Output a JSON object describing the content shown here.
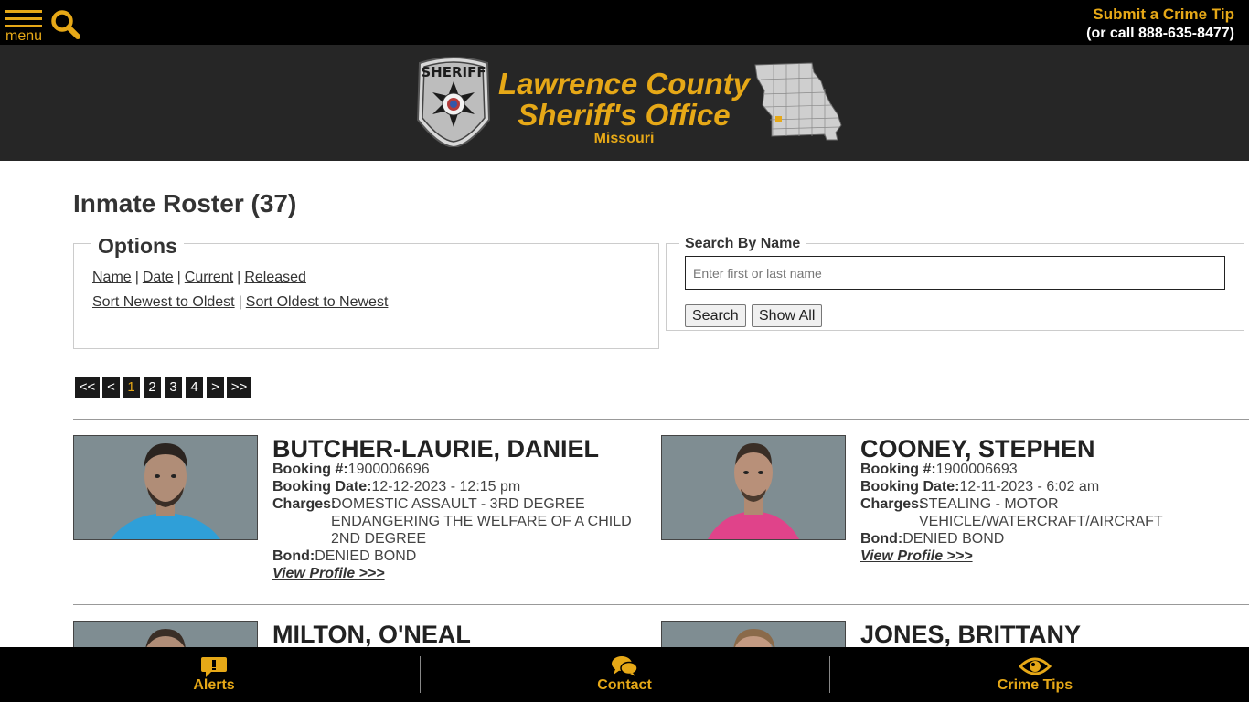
{
  "header": {
    "menu_label": "menu",
    "tip_title": "Submit a Crime Tip",
    "tip_phone": "(or call 888-635-8477)"
  },
  "brand": {
    "line1": "Lawrence County",
    "line2": "Sheriff's Office",
    "state": "Missouri",
    "badge_text": "SHERIFF"
  },
  "page": {
    "title": "Inmate Roster (37)"
  },
  "options": {
    "legend": "Options",
    "sort_by": [
      "Name",
      "Date",
      "Current",
      "Released"
    ],
    "sort_order": [
      "Sort Newest to Oldest",
      "Sort Oldest to Newest"
    ],
    "separator": "|"
  },
  "search": {
    "legend": "Search By Name",
    "placeholder": "Enter first or last name",
    "search_button": "Search",
    "show_all_button": "Show All"
  },
  "pagination": {
    "first": "<<",
    "prev": "<",
    "pages": [
      "1",
      "2",
      "3",
      "4"
    ],
    "current": "1",
    "next": ">",
    "last": ">>"
  },
  "labels": {
    "booking_no": "Booking #:",
    "booking_date": "Booking Date:",
    "charges": "Charges:",
    "bond": "Bond:",
    "view_profile": "View Profile >>>"
  },
  "inmates": [
    {
      "name": "BUTCHER-LAURIE, DANIEL",
      "booking_no": "1900006696",
      "booking_date": "12-12-2023 - 12:15 pm",
      "charges": [
        "DOMESTIC ASSAULT - 3RD DEGREE",
        "ENDANGERING THE WELFARE OF A CHILD 2ND DEGREE"
      ],
      "bond": "DENIED BOND",
      "shirt_color": "#2f9fd8"
    },
    {
      "name": "COONEY, STEPHEN",
      "booking_no": "1900006693",
      "booking_date": "12-11-2023 - 6:02 am",
      "charges": [
        "STEALING - MOTOR VEHICLE/WATERCRAFT/AIRCRAFT"
      ],
      "bond": "DENIED BOND",
      "shirt_color": "#e0438a"
    },
    {
      "name": "MILTON, O'NEAL"
    },
    {
      "name": "JONES, BRITTANY"
    }
  ],
  "footer": {
    "items": [
      {
        "label": "Alerts",
        "icon": "alert-bubble-icon"
      },
      {
        "label": "Contact",
        "icon": "chat-bubbles-icon"
      },
      {
        "label": "Crime Tips",
        "icon": "eye-icon"
      }
    ]
  },
  "colors": {
    "accent": "#e6a817",
    "topbar": "#000000",
    "banner": "#262626"
  }
}
